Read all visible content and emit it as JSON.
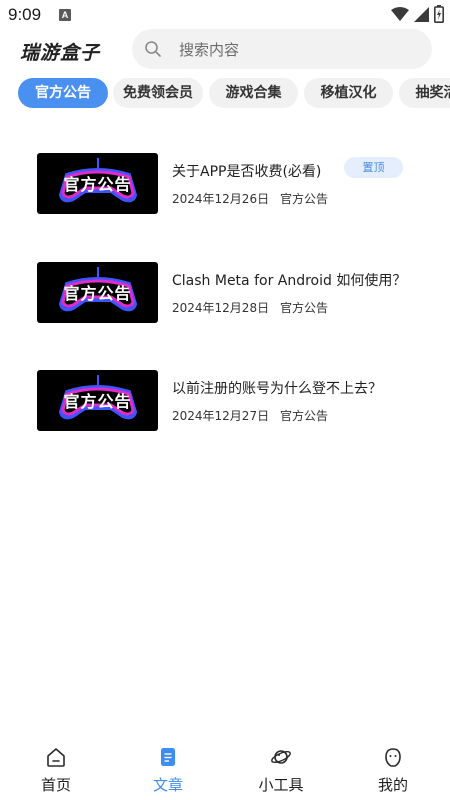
{
  "status_bar": {
    "time": "9:09",
    "notification_badge": "A",
    "icons": [
      "wifi-icon",
      "signal-icon",
      "battery-icon"
    ]
  },
  "header": {
    "app_title": "瑞游盒子",
    "search_placeholder": "搜索内容"
  },
  "tabs": [
    {
      "label": "官方公告",
      "active": true
    },
    {
      "label": "免费领会员",
      "active": false
    },
    {
      "label": "游戏合集",
      "active": false
    },
    {
      "label": "移植汉化",
      "active": false
    },
    {
      "label": "抽奖活动",
      "active": false
    }
  ],
  "articles": [
    {
      "thumb_text": "官方公告",
      "title": "关于APP是否收费(必看)",
      "date": "2024年12月26日",
      "category": "官方公告",
      "badge": "置顶"
    },
    {
      "thumb_text": "官方公告",
      "title": "Clash Meta for Android 如何使用？",
      "date": "2024年12月28日",
      "category": "官方公告",
      "badge": ""
    },
    {
      "thumb_text": "官方公告",
      "title": "以前注册的账号为什么登不上去？",
      "date": "2024年12月27日",
      "category": "官方公告",
      "badge": ""
    }
  ],
  "bottom_nav": [
    {
      "label": "首页",
      "icon": "home-icon",
      "active": false
    },
    {
      "label": "文章",
      "icon": "article-icon",
      "active": true
    },
    {
      "label": "小工具",
      "icon": "planet-icon",
      "active": false
    },
    {
      "label": "我的",
      "icon": "profile-icon",
      "active": false
    }
  ],
  "colors": {
    "accent": "#4a90f0",
    "badge_bg": "#e4eefc",
    "badge_text": "#4a8ae6",
    "thumb_bg": "#000000"
  }
}
